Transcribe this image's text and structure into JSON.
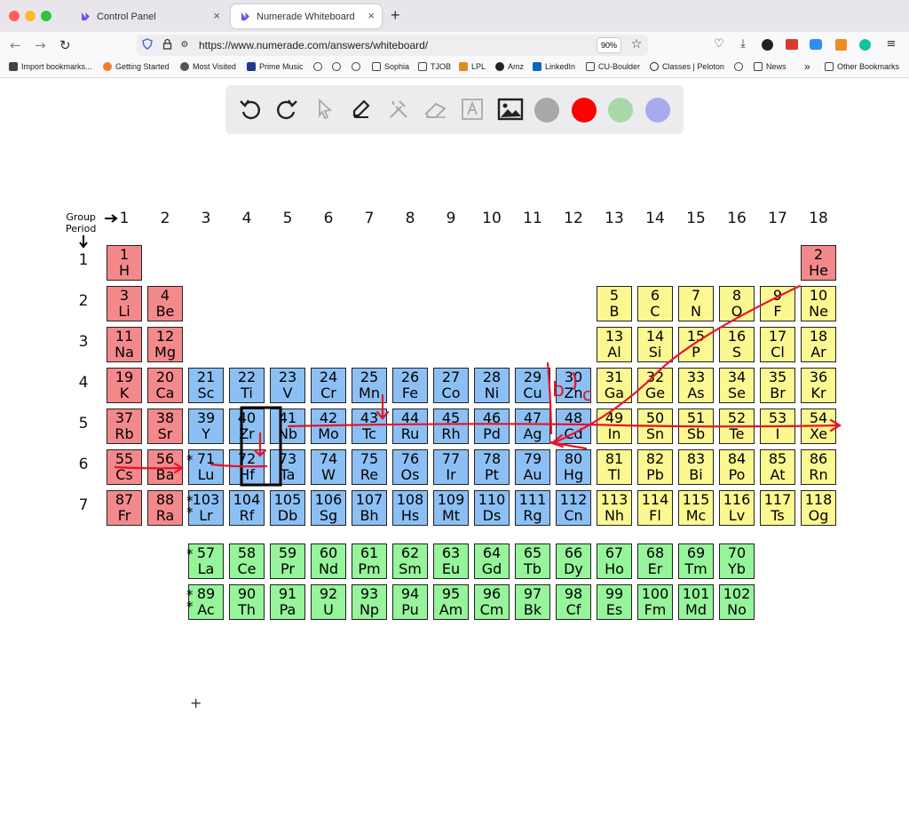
{
  "browser": {
    "tabs": [
      {
        "title": "Control Panel",
        "close": "×"
      },
      {
        "title": "Numerade Whiteboard",
        "close": "×"
      }
    ],
    "new_tab": "+",
    "url": "https://www.numerade.com/answers/whiteboard/",
    "zoom": "90%",
    "bookmarks": [
      "Import bookmarks...",
      "Getting Started",
      "Most Visited",
      "Prime Music",
      "Sophia",
      "TJOB",
      "LPL",
      "Amz",
      "LinkedIn",
      "CU-Boulder",
      "Classes | Peloton",
      "News",
      "Other Bookmarks"
    ],
    "bookmarks_more": "»"
  },
  "toolbar": {
    "tools": [
      "undo-icon",
      "redo-icon",
      "pointer-icon",
      "pen-icon",
      "tools-icon",
      "eraser-icon",
      "text-icon",
      "image-icon"
    ],
    "colors": [
      "#a8a8a8",
      "#ff0000",
      "#a8d8a8",
      "#a8aaee"
    ]
  },
  "table": {
    "group_label": "Group",
    "period_label": "Period",
    "groups": [
      "1",
      "2",
      "3",
      "4",
      "5",
      "6",
      "7",
      "8",
      "9",
      "10",
      "11",
      "12",
      "13",
      "14",
      "15",
      "16",
      "17",
      "18"
    ],
    "periods": [
      "1",
      "2",
      "3",
      "4",
      "5",
      "6",
      "7"
    ],
    "star": "*",
    "colors": {
      "red": "#f4898c",
      "blue": "#8cc0f4",
      "yellow": "#fbf891",
      "green": "#96f49b"
    },
    "rows": [
      [
        [
          "1",
          "H",
          "red",
          1
        ],
        [
          "2",
          "He",
          "red",
          18
        ]
      ],
      [
        [
          "3",
          "Li",
          "red",
          1
        ],
        [
          "4",
          "Be",
          "red",
          2
        ],
        [
          "5",
          "B",
          "yellow",
          13
        ],
        [
          "6",
          "C",
          "yellow",
          14
        ],
        [
          "7",
          "N",
          "yellow",
          15
        ],
        [
          "8",
          "O",
          "yellow",
          16
        ],
        [
          "9",
          "F",
          "yellow",
          17
        ],
        [
          "10",
          "Ne",
          "yellow",
          18
        ]
      ],
      [
        [
          "11",
          "Na",
          "red",
          1
        ],
        [
          "12",
          "Mg",
          "red",
          2
        ],
        [
          "13",
          "Al",
          "yellow",
          13
        ],
        [
          "14",
          "Si",
          "yellow",
          14
        ],
        [
          "15",
          "P",
          "yellow",
          15
        ],
        [
          "16",
          "S",
          "yellow",
          16
        ],
        [
          "17",
          "Cl",
          "yellow",
          17
        ],
        [
          "18",
          "Ar",
          "yellow",
          18
        ]
      ],
      [
        [
          "19",
          "K",
          "red",
          1
        ],
        [
          "20",
          "Ca",
          "red",
          2
        ],
        [
          "21",
          "Sc",
          "blue",
          3
        ],
        [
          "22",
          "Ti",
          "blue",
          4
        ],
        [
          "23",
          "V",
          "blue",
          5
        ],
        [
          "24",
          "Cr",
          "blue",
          6
        ],
        [
          "25",
          "Mn",
          "blue",
          7
        ],
        [
          "26",
          "Fe",
          "blue",
          8
        ],
        [
          "27",
          "Co",
          "blue",
          9
        ],
        [
          "28",
          "Ni",
          "blue",
          10
        ],
        [
          "29",
          "Cu",
          "blue",
          11
        ],
        [
          "30",
          "Zn",
          "blue",
          12
        ],
        [
          "31",
          "Ga",
          "yellow",
          13
        ],
        [
          "32",
          "Ge",
          "yellow",
          14
        ],
        [
          "33",
          "As",
          "yellow",
          15
        ],
        [
          "34",
          "Se",
          "yellow",
          16
        ],
        [
          "35",
          "Br",
          "yellow",
          17
        ],
        [
          "36",
          "Kr",
          "yellow",
          18
        ]
      ],
      [
        [
          "37",
          "Rb",
          "red",
          1
        ],
        [
          "38",
          "Sr",
          "red",
          2
        ],
        [
          "39",
          "Y",
          "blue",
          3
        ],
        [
          "40",
          "Zr",
          "blue",
          4
        ],
        [
          "41",
          "Nb",
          "blue",
          5
        ],
        [
          "42",
          "Mo",
          "blue",
          6
        ],
        [
          "43",
          "Tc",
          "blue",
          7
        ],
        [
          "44",
          "Ru",
          "blue",
          8
        ],
        [
          "45",
          "Rh",
          "blue",
          9
        ],
        [
          "46",
          "Pd",
          "blue",
          10
        ],
        [
          "47",
          "Ag",
          "blue",
          11
        ],
        [
          "48",
          "Cd",
          "blue",
          12
        ],
        [
          "49",
          "In",
          "yellow",
          13
        ],
        [
          "50",
          "Sn",
          "yellow",
          14
        ],
        [
          "51",
          "Sb",
          "yellow",
          15
        ],
        [
          "52",
          "Te",
          "yellow",
          16
        ],
        [
          "53",
          "I",
          "yellow",
          17
        ],
        [
          "54",
          "Xe",
          "yellow",
          18
        ]
      ],
      [
        [
          "55",
          "Cs",
          "red",
          1
        ],
        [
          "56",
          "Ba",
          "red",
          2
        ],
        [
          "71",
          "Lu",
          "blue",
          3
        ],
        [
          "72",
          "Hf",
          "blue",
          4
        ],
        [
          "73",
          "Ta",
          "blue",
          5
        ],
        [
          "74",
          "W",
          "blue",
          6
        ],
        [
          "75",
          "Re",
          "blue",
          7
        ],
        [
          "76",
          "Os",
          "blue",
          8
        ],
        [
          "77",
          "Ir",
          "blue",
          9
        ],
        [
          "78",
          "Pt",
          "blue",
          10
        ],
        [
          "79",
          "Au",
          "blue",
          11
        ],
        [
          "80",
          "Hg",
          "blue",
          12
        ],
        [
          "81",
          "Tl",
          "yellow",
          13
        ],
        [
          "82",
          "Pb",
          "yellow",
          14
        ],
        [
          "83",
          "Bi",
          "yellow",
          15
        ],
        [
          "84",
          "Po",
          "yellow",
          16
        ],
        [
          "85",
          "At",
          "yellow",
          17
        ],
        [
          "86",
          "Rn",
          "yellow",
          18
        ]
      ],
      [
        [
          "87",
          "Fr",
          "red",
          1
        ],
        [
          "88",
          "Ra",
          "red",
          2
        ],
        [
          "103",
          "Lr",
          "blue",
          3
        ],
        [
          "104",
          "Rf",
          "blue",
          4
        ],
        [
          "105",
          "Db",
          "blue",
          5
        ],
        [
          "106",
          "Sg",
          "blue",
          6
        ],
        [
          "107",
          "Bh",
          "blue",
          7
        ],
        [
          "108",
          "Hs",
          "blue",
          8
        ],
        [
          "109",
          "Mt",
          "blue",
          9
        ],
        [
          "110",
          "Ds",
          "blue",
          10
        ],
        [
          "111",
          "Rg",
          "blue",
          11
        ],
        [
          "112",
          "Cn",
          "blue",
          12
        ],
        [
          "113",
          "Nh",
          "yellow",
          13
        ],
        [
          "114",
          "Fl",
          "yellow",
          14
        ],
        [
          "115",
          "Mc",
          "yellow",
          15
        ],
        [
          "116",
          "Lv",
          "yellow",
          16
        ],
        [
          "117",
          "Ts",
          "yellow",
          17
        ],
        [
          "118",
          "Og",
          "yellow",
          18
        ]
      ]
    ],
    "lanthanides": [
      [
        "57",
        "La"
      ],
      [
        "58",
        "Ce"
      ],
      [
        "59",
        "Pr"
      ],
      [
        "60",
        "Nd"
      ],
      [
        "61",
        "Pm"
      ],
      [
        "62",
        "Sm"
      ],
      [
        "63",
        "Eu"
      ],
      [
        "64",
        "Gd"
      ],
      [
        "65",
        "Tb"
      ],
      [
        "66",
        "Dy"
      ],
      [
        "67",
        "Ho"
      ],
      [
        "68",
        "Er"
      ],
      [
        "69",
        "Tm"
      ],
      [
        "70",
        "Yb"
      ]
    ],
    "actinides": [
      [
        "89",
        "Ac"
      ],
      [
        "90",
        "Th"
      ],
      [
        "91",
        "Pa"
      ],
      [
        "92",
        "U"
      ],
      [
        "93",
        "Np"
      ],
      [
        "94",
        "Pu"
      ],
      [
        "95",
        "Am"
      ],
      [
        "96",
        "Cm"
      ],
      [
        "97",
        "Bk"
      ],
      [
        "98",
        "Cf"
      ],
      [
        "99",
        "Es"
      ],
      [
        "100",
        "Fm"
      ],
      [
        "101",
        "Md"
      ],
      [
        "102",
        "No"
      ]
    ],
    "highlighted": [
      "40",
      "72"
    ]
  },
  "annotations": {
    "ink_color": "#e8132a",
    "labels": [
      "b",
      "c"
    ]
  }
}
